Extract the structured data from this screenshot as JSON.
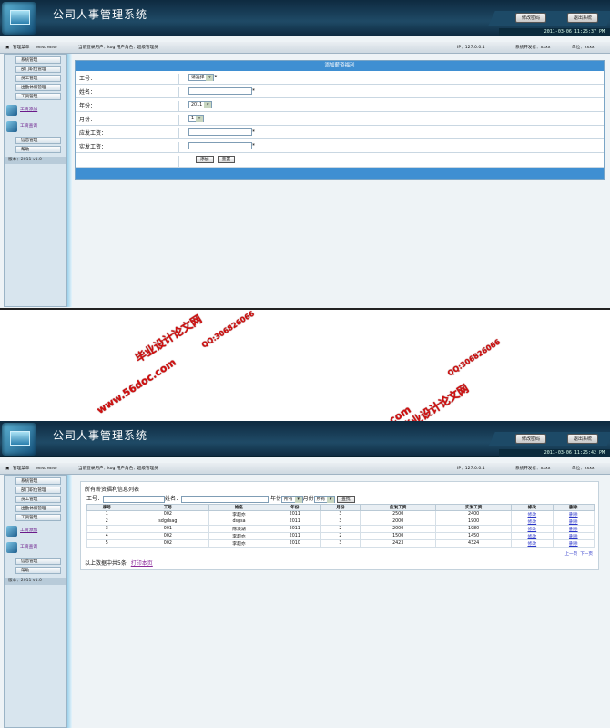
{
  "app": {
    "title": "公司人事管理系统",
    "btn_change_pwd": "修改密码",
    "btn_logout": "退出系统"
  },
  "shot1": {
    "clock": "2011-03-06 11:25:37 PM",
    "bar": {
      "menu": "管理菜单",
      "menu_en": "MENU MENU",
      "user": "当前登录用户：kog  用户角色：超级管理员",
      "ip": "IP：127.0.0.1",
      "dev": "系统开发者：xxxx",
      "unit": "单位：xxxx"
    },
    "form": {
      "title": "添加薪资福利",
      "fields": [
        {
          "label": "工号：",
          "type": "select",
          "value": "请选择",
          "star": "*"
        },
        {
          "label": "姓名：",
          "type": "input",
          "value": "",
          "star": "*"
        },
        {
          "label": "年份：",
          "type": "select",
          "value": "2011",
          "star": ""
        },
        {
          "label": "月份：",
          "type": "select",
          "value": "1",
          "star": ""
        },
        {
          "label": "应发工资：",
          "type": "input",
          "value": "",
          "star": "*"
        },
        {
          "label": "实发工资：",
          "type": "input",
          "value": "",
          "star": "*"
        }
      ],
      "btn_add": "添加",
      "btn_reset": "重置"
    }
  },
  "shot2": {
    "clock": "2011-03-06 11:25:42 PM",
    "bar": {
      "menu": "管理菜单",
      "menu_en": "MENU MENU",
      "user": "当前登录用户：kog  用户角色：超级管理员",
      "ip": "IP：127.0.0.1",
      "dev": "系统开发者：xxxx",
      "unit": "单位：xxxx"
    },
    "list": {
      "title": "所有薪资福利信息列表",
      "filter": {
        "id_label": "工号：",
        "name_label": "姓名：",
        "year_label": "年份",
        "year_value": "所有",
        "month_label": "月份",
        "month_value": "所有",
        "search_btn": "查找"
      },
      "headers": [
        "序号",
        "工号",
        "姓名",
        "年份",
        "月份",
        "应发工资",
        "实发工资",
        "修改",
        "删除"
      ],
      "rows": [
        [
          "1",
          "002",
          "李超亦",
          "2011",
          "3",
          "2500",
          "2400",
          "修改",
          "删除"
        ],
        [
          "2",
          "sdgdsag",
          "dsgsa",
          "2011",
          "3",
          "2000",
          "1900",
          "修改",
          "删除"
        ],
        [
          "3",
          "001",
          "陈浪湖",
          "2011",
          "2",
          "2000",
          "1980",
          "修改",
          "删除"
        ],
        [
          "4",
          "002",
          "李超亦",
          "2011",
          "2",
          "1500",
          "1450",
          "修改",
          "删除"
        ],
        [
          "5",
          "002",
          "李超亦",
          "2010",
          "3",
          "2423",
          "4324",
          "修改",
          "删除"
        ]
      ],
      "pager_prev": "上一页",
      "pager_next": "下一页",
      "summary": "以上数据中共5条",
      "print_link": "打印本页"
    }
  },
  "sidebar": {
    "items": [
      "系统管理",
      "部门职位管理",
      "员工管理",
      "出勤休假管理",
      "工资管理"
    ],
    "sub": [
      "工资添加",
      "工资查询"
    ],
    "bottom": [
      "信息管理",
      "帮助"
    ],
    "version": "版本：2011 v1.0"
  },
  "watermarks": [
    "www.56doc.com",
    "QQ:306826066",
    "毕业设计论文网",
    "www.56doc.com",
    "QQ:306826066",
    "毕业设计论文网"
  ],
  "colors": {
    "header": "#1f4a66",
    "panel_title": "#3f8fd2",
    "watermark": "#d10f0f",
    "link": "#2a35c9"
  }
}
